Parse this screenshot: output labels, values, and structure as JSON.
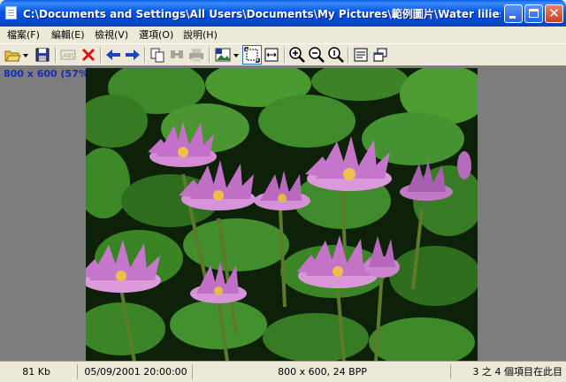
{
  "window": {
    "title": "C:\\Documents and Settings\\All Users\\Documents\\My Pictures\\範例圖片\\Water lilies.jpg - Universa..."
  },
  "menu": {
    "items": [
      {
        "label": "檔案(F)"
      },
      {
        "label": "編輯(E)"
      },
      {
        "label": "檢視(V)"
      },
      {
        "label": "選項(O)"
      },
      {
        "label": "說明(H)"
      }
    ]
  },
  "toolbar": {
    "icons": [
      "open-folder-icon",
      "dropdown-arrow-icon",
      "save-icon",
      "ocr-icon",
      "delete-icon",
      "back-arrow-icon",
      "forward-arrow-icon",
      "copy-icon",
      "find-icon",
      "print-icon",
      "image-edit-icon",
      "dropdown-arrow-icon",
      "fit-to-window-icon",
      "fit-width-icon",
      "zoom-in-icon",
      "zoom-out-icon",
      "zoom-actual-icon",
      "properties-icon",
      "multi-window-icon"
    ]
  },
  "content": {
    "zoom_label": "800 x 600 (57%)",
    "image": "water-lilies-photo"
  },
  "status": {
    "size": "81 Kb",
    "date": "05/09/2001 20:00:00",
    "dimensions": "800 x 600, 24 BPP",
    "position": "3 之 4 個項目在此目"
  },
  "colors": {
    "titlebar": "#0A5FE8",
    "chrome": "#ECE9D8",
    "viewer_bg": "#7D7D7D",
    "zoom_label": "#1A2BB3"
  }
}
